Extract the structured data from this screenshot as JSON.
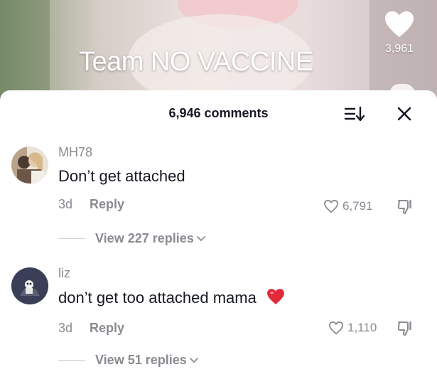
{
  "video": {
    "caption": "Team NO VACCINE",
    "like_count": "3,961"
  },
  "sheet": {
    "title": "6,946 comments"
  },
  "comments": [
    {
      "username": "MH78",
      "text": "Don’t get attached",
      "age": "3d",
      "reply_label": "Reply",
      "like_count": "6,791",
      "view_replies": "View 227 replies"
    },
    {
      "username": "liz",
      "text": "don’t get too attached mama",
      "emoji": "red-heart",
      "age": "3d",
      "reply_label": "Reply",
      "like_count": "1,110",
      "view_replies": "View 51 replies"
    }
  ],
  "colors": {
    "text_primary": "#161823",
    "text_secondary": "#8a8b91",
    "heart_red": "#e02a3a"
  },
  "icons": [
    "heart-icon",
    "sort-icon",
    "close-icon",
    "like-outline-icon",
    "dislike-icon",
    "chevron-down-icon"
  ]
}
